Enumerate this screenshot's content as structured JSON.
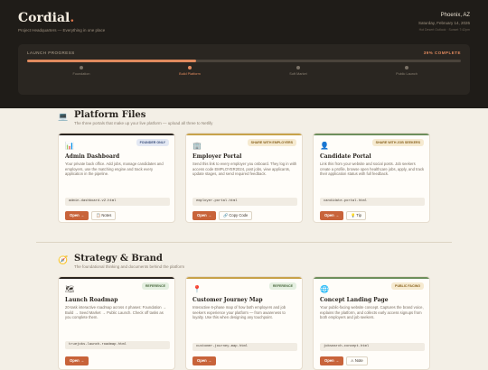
{
  "header": {
    "brand": "Cordial",
    "brand_dot": ".",
    "subtitle": "Project Headquarters — Everything in one place",
    "location": "Phoenix, AZ",
    "date": "Saturday, February 14, 2026",
    "weather": "Hot Desert Outlook · Sunset 7:42pm"
  },
  "progress": {
    "label": "LAUNCH PROGRESS",
    "percent_label": "39% COMPLETE",
    "percent": 39,
    "steps": [
      {
        "label": "Foundation",
        "active": false
      },
      {
        "label": "Build Platform",
        "active": true
      },
      {
        "label": "Soft Market",
        "active": false
      },
      {
        "label": "Public Launch",
        "active": false
      }
    ]
  },
  "colors": {
    "accent": "#c8633a",
    "bar_dark": "#2a2520",
    "bar_gold": "#c7a24a",
    "bar_sage": "#6d8f5c"
  },
  "sections": [
    {
      "icon": "laptop-icon",
      "title": "Platform Files",
      "description": "The three portals that make up your live platform — upload all three to Netlify",
      "cards": [
        {
          "icon": "bar-chart-icon",
          "badge": "FOUNDER ONLY",
          "title": "Admin Dashboard",
          "description": "Your private back office. Add jobs, manage candidates and employers, use the matching engine and track every application in the pipeline.",
          "file": "admin-dashboard-v2.html",
          "open_label": "Open →",
          "secondary_label": "📋 Notes"
        },
        {
          "icon": "building-icon",
          "badge": "SHARE WITH EMPLOYERS",
          "title": "Employer Portal",
          "description": "Send this link to every employer you onboard. They log in with access code EMPLOYER2024, post jobs, view applicants, update stages, and send required feedback.",
          "file": "employer-portal.html",
          "open_label": "Open →",
          "secondary_label": "🔗 Copy Code"
        },
        {
          "icon": "person-icon",
          "badge": "SHARE WITH JOB SEEKERS",
          "title": "Candidate Portal",
          "description": "Link this from your website and social posts. Job seekers create a profile, browse open healthcare jobs, apply, and track their application status with full feedback.",
          "file": "candidate-portal.html",
          "open_label": "Open →",
          "secondary_label": "💡 Tip"
        }
      ]
    },
    {
      "icon": "compass-icon",
      "title": "Strategy & Brand",
      "description": "The foundational thinking and documents behind the platform",
      "cards": [
        {
          "icon": "map-icon",
          "badge": "REFERENCE",
          "title": "Launch Roadmap",
          "description": "20-task interactive roadmap across 4 phases: Foundation → Build → Seed Market → Public Launch. Check off tasks as you complete them.",
          "file": "truejobs-launch-roadmap.html",
          "open_label": "Open →",
          "secondary_label": ""
        },
        {
          "icon": "pin-icon",
          "badge": "REFERENCE",
          "title": "Customer Journey Map",
          "description": "Interactive 6-phase map of how both employers and job seekers experience your platform — from awareness to loyalty. Use this when designing any touchpoint.",
          "file": "customer-journey-map.html",
          "open_label": "Open →",
          "secondary_label": ""
        },
        {
          "icon": "globe-icon",
          "badge": "PUBLIC FACING",
          "title": "Concept Landing Page",
          "description": "Your public-facing website concept. Captures the brand voice, explains the platform, and collects early access signups from both employers and job seekers.",
          "file": "jobsearch-concept.html",
          "open_label": "Open →",
          "secondary_label": "⚠ Note"
        }
      ]
    }
  ]
}
